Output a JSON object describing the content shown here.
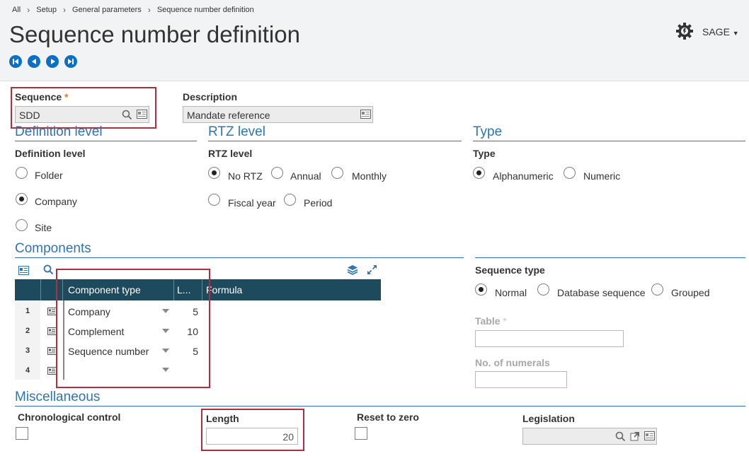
{
  "breadcrumb": [
    "All",
    "Setup",
    "General parameters",
    "Sequence number definition"
  ],
  "title": "Sequence number definition",
  "user": "SAGE",
  "sequence": {
    "label": "Sequence",
    "value": "SDD"
  },
  "description": {
    "label": "Description",
    "value": "Mandate reference"
  },
  "definition_level": {
    "section": "Definition level",
    "label": "Definition level",
    "options": [
      "Folder",
      "Company",
      "Site"
    ],
    "selected": "Company"
  },
  "rtz_level": {
    "section": "RTZ level",
    "label": "RTZ level",
    "options": [
      "No RTZ",
      "Annual",
      "Monthly",
      "Fiscal year",
      "Period"
    ],
    "selected": "No RTZ"
  },
  "type": {
    "section": "Type",
    "label": "Type",
    "options": [
      "Alphanumeric",
      "Numeric"
    ],
    "selected": "Alphanumeric"
  },
  "components": {
    "section": "Components",
    "columns": [
      "Component type",
      "L...",
      "Formula"
    ],
    "rows": [
      {
        "num": "1",
        "type": "Company",
        "length": "5",
        "formula": ""
      },
      {
        "num": "2",
        "type": "Complement",
        "length": "10",
        "formula": ""
      },
      {
        "num": "3",
        "type": "Sequence number",
        "length": "5",
        "formula": ""
      },
      {
        "num": "4",
        "type": "",
        "length": "",
        "formula": ""
      }
    ]
  },
  "sequence_type": {
    "label": "Sequence type",
    "options": [
      "Normal",
      "Database sequence",
      "Grouped"
    ],
    "selected": "Normal"
  },
  "table": {
    "label": "Table",
    "value": ""
  },
  "numerals": {
    "label": "No. of numerals",
    "value": ""
  },
  "misc": {
    "section": "Miscellaneous",
    "chrono_label": "Chronological control",
    "chrono_checked": false,
    "length_label": "Length",
    "length_value": "20",
    "reset_label": "Reset to zero",
    "reset_checked": false,
    "legislation_label": "Legislation",
    "legislation_value": ""
  },
  "colors": {
    "accent": "#2e75b5",
    "grid_header": "#1e4a5d",
    "highlight": "#b22d3d",
    "nav": "#0a70c7"
  }
}
